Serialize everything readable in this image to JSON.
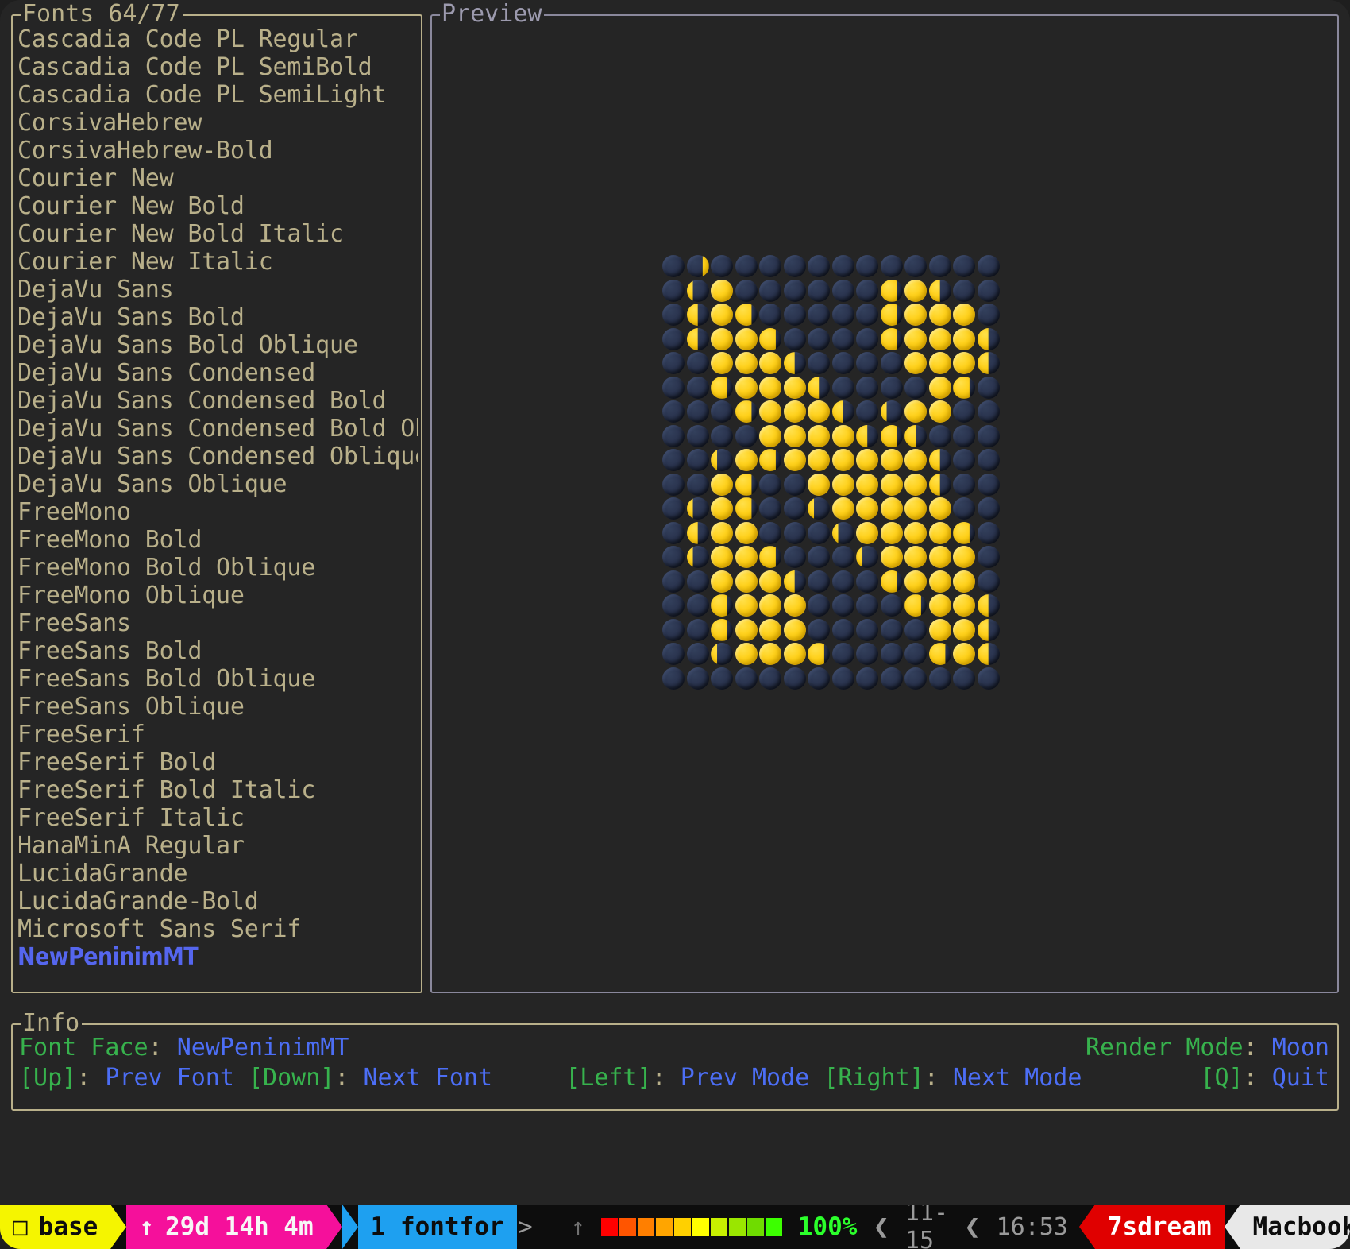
{
  "window": {
    "background": "#252525"
  },
  "fonts_panel": {
    "title": "Fonts 64/77",
    "border_color": "#b9b08a",
    "text_color": "#b9b08a",
    "selected_color": "#5566ee",
    "current_index": 64,
    "total": 77,
    "items": [
      {
        "label": "Cascadia Code PL Regular",
        "selected": false
      },
      {
        "label": "Cascadia Code PL SemiBold",
        "selected": false
      },
      {
        "label": "Cascadia Code PL SemiLight",
        "selected": false
      },
      {
        "label": "CorsivaHebrew",
        "selected": false
      },
      {
        "label": "CorsivaHebrew-Bold",
        "selected": false
      },
      {
        "label": "Courier New",
        "selected": false
      },
      {
        "label": "Courier New Bold",
        "selected": false
      },
      {
        "label": "Courier New Bold Italic",
        "selected": false
      },
      {
        "label": "Courier New Italic",
        "selected": false
      },
      {
        "label": "DejaVu Sans",
        "selected": false
      },
      {
        "label": "DejaVu Sans Bold",
        "selected": false
      },
      {
        "label": "DejaVu Sans Bold Oblique",
        "selected": false
      },
      {
        "label": "DejaVu Sans Condensed",
        "selected": false
      },
      {
        "label": "DejaVu Sans Condensed Bold",
        "selected": false
      },
      {
        "label": "DejaVu Sans Condensed Bold Obl",
        "selected": false
      },
      {
        "label": "DejaVu Sans Condensed Oblique",
        "selected": false
      },
      {
        "label": "DejaVu Sans Oblique",
        "selected": false
      },
      {
        "label": "FreeMono",
        "selected": false
      },
      {
        "label": "FreeMono Bold",
        "selected": false
      },
      {
        "label": "FreeMono Bold Oblique",
        "selected": false
      },
      {
        "label": "FreeMono Oblique",
        "selected": false
      },
      {
        "label": "FreeSans",
        "selected": false
      },
      {
        "label": "FreeSans Bold",
        "selected": false
      },
      {
        "label": "FreeSans Bold Oblique",
        "selected": false
      },
      {
        "label": "FreeSans Oblique",
        "selected": false
      },
      {
        "label": "FreeSerif",
        "selected": false
      },
      {
        "label": "FreeSerif Bold",
        "selected": false
      },
      {
        "label": "FreeSerif Bold Italic",
        "selected": false
      },
      {
        "label": "FreeSerif Italic",
        "selected": false
      },
      {
        "label": "HanaMinA Regular",
        "selected": false
      },
      {
        "label": "LucidaGrande",
        "selected": false
      },
      {
        "label": "LucidaGrande-Bold",
        "selected": false
      },
      {
        "label": "Microsoft Sans Serif",
        "selected": false
      },
      {
        "label": "NewPeninimMT",
        "selected": true
      }
    ]
  },
  "preview_panel": {
    "title": "Preview",
    "border_color": "#8a889c",
    "render_mode": "Moon",
    "grid": {
      "columns": 14,
      "rows": 20,
      "glyph_color_lit": "#ffd21f",
      "glyph_color_dark": "#2b3550",
      "cells": [
        [
          "d",
          "c",
          "d",
          "d",
          "d",
          "d",
          "d",
          "d",
          "d",
          "d",
          "d",
          "d",
          "d",
          "d"
        ],
        [
          "d",
          "C",
          "f",
          "d",
          "d",
          "d",
          "d",
          "d",
          "d",
          "G",
          "f",
          "H",
          "d",
          "d"
        ],
        [
          "d",
          "H",
          "f",
          "G",
          "d",
          "d",
          "d",
          "d",
          "d",
          "G",
          "f",
          "f",
          "f",
          "d"
        ],
        [
          "d",
          "H",
          "f",
          "f",
          "G",
          "d",
          "d",
          "d",
          "d",
          "G",
          "f",
          "f",
          "f",
          "H"
        ],
        [
          "d",
          "d",
          "f",
          "f",
          "f",
          "H",
          "d",
          "d",
          "d",
          "d",
          "f",
          "f",
          "f",
          "H"
        ],
        [
          "d",
          "d",
          "G",
          "f",
          "f",
          "f",
          "H",
          "d",
          "d",
          "d",
          "d",
          "f",
          "G",
          "d"
        ],
        [
          "d",
          "d",
          "d",
          "G",
          "f",
          "f",
          "f",
          "H",
          "d",
          "C",
          "f",
          "f",
          "d",
          "d"
        ],
        [
          "d",
          "d",
          "d",
          "d",
          "f",
          "f",
          "f",
          "f",
          "H",
          "G",
          "H",
          "d",
          "d",
          "d"
        ],
        [
          "d",
          "d",
          "C",
          "f",
          "G",
          "f",
          "f",
          "f",
          "f",
          "f",
          "f",
          "H",
          "d",
          "d"
        ],
        [
          "d",
          "d",
          "f",
          "G",
          "d",
          "d",
          "f",
          "f",
          "f",
          "f",
          "f",
          "H",
          "d",
          "d"
        ],
        [
          "d",
          "C",
          "f",
          "G",
          "d",
          "d",
          "C",
          "f",
          "f",
          "f",
          "f",
          "f",
          "d",
          "d"
        ],
        [
          "d",
          "H",
          "f",
          "f",
          "d",
          "d",
          "d",
          "C",
          "f",
          "f",
          "f",
          "f",
          "G",
          "d"
        ],
        [
          "d",
          "C",
          "f",
          "f",
          "G",
          "d",
          "d",
          "d",
          "C",
          "f",
          "f",
          "f",
          "f",
          "d"
        ],
        [
          "d",
          "d",
          "f",
          "f",
          "f",
          "H",
          "d",
          "d",
          "d",
          "G",
          "f",
          "f",
          "f",
          "d"
        ],
        [
          "d",
          "d",
          "G",
          "f",
          "f",
          "f",
          "d",
          "d",
          "d",
          "d",
          "G",
          "f",
          "f",
          "H"
        ],
        [
          "d",
          "d",
          "G",
          "f",
          "f",
          "f",
          "d",
          "d",
          "d",
          "d",
          "d",
          "f",
          "f",
          "H"
        ],
        [
          "d",
          "d",
          "C",
          "f",
          "f",
          "f",
          "G",
          "d",
          "d",
          "d",
          "d",
          "G",
          "f",
          "H"
        ],
        [
          "d",
          "d",
          "d",
          "d",
          "d",
          "d",
          "d",
          "d",
          "d",
          "d",
          "d",
          "d",
          "d",
          "d"
        ]
      ]
    }
  },
  "info_panel": {
    "title": "Info",
    "border_color": "#b9b08a",
    "font_face_label": "Font Face",
    "font_face_value": "NewPeninimMT",
    "render_mode_label": "Render Mode",
    "render_mode_value": "Moon",
    "colon": ":",
    "keys": {
      "up": "[Up]",
      "up_action": "Prev Font",
      "down": "[Down]",
      "down_action": "Next Font",
      "left": "[Left]",
      "left_action": "Prev Mode",
      "right": "[Right]",
      "right_action": "Next Mode",
      "quit": "[Q]",
      "quit_action": "Quit"
    },
    "label_color": "#37b24d",
    "value_color": "#4c6ef5"
  },
  "statusbar": {
    "env_icon": "□",
    "env_label": "base",
    "env_bg": "#f5f500",
    "uptime_icon": "↑",
    "uptime_label": "29d 14h 4m",
    "uptime_bg": "#f5109b",
    "session_label": "1 fontfor",
    "session_bg": "#1ea0f0",
    "session_chevron": ">",
    "battery_icon": "↑",
    "battery_percent": "100%",
    "battery_blocks": [
      "#ff0000",
      "#ff5500",
      "#ff7f00",
      "#ffa500",
      "#ffd000",
      "#ffff00",
      "#c8f000",
      "#9ae600",
      "#6fdc00",
      "#3cff00"
    ],
    "battery_percent_color": "#2bff2b",
    "date": "11-15",
    "time": "16:53",
    "chevron": "❮",
    "user": "7sdream",
    "user_bg": "#e00000",
    "host": "Macbook",
    "host_bg": "#e8e8e8"
  }
}
